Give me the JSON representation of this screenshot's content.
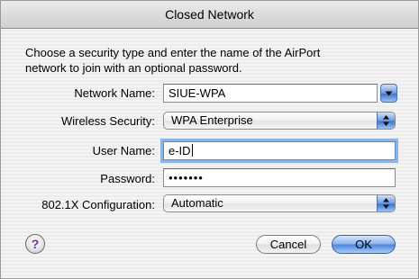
{
  "window": {
    "title": "Closed Network"
  },
  "prompt": {
    "line1": "Choose a security type and enter the name of the AirPort",
    "line2": "network to join with an optional password."
  },
  "form": {
    "network_name_label": "Network Name:",
    "network_name_value": "SIUE-WPA",
    "wireless_security_label": "Wireless Security:",
    "wireless_security_value": "WPA Enterprise",
    "user_name_label": "User Name:",
    "user_name_value": "e-ID",
    "password_label": "Password:",
    "password_value": "•••••••",
    "config_label": "802.1X Configuration:",
    "config_value": "Automatic"
  },
  "buttons": {
    "help_label": "?",
    "cancel_label": "Cancel",
    "ok_label": "OK"
  },
  "icons": {
    "stepper": "up-down-arrows-icon",
    "combo_arrow": "chevron-down-icon"
  },
  "colors": {
    "accent_blue": "#4f87da",
    "focus_ring": "#8cb3ea",
    "help_glyph": "#6b2fa0"
  }
}
